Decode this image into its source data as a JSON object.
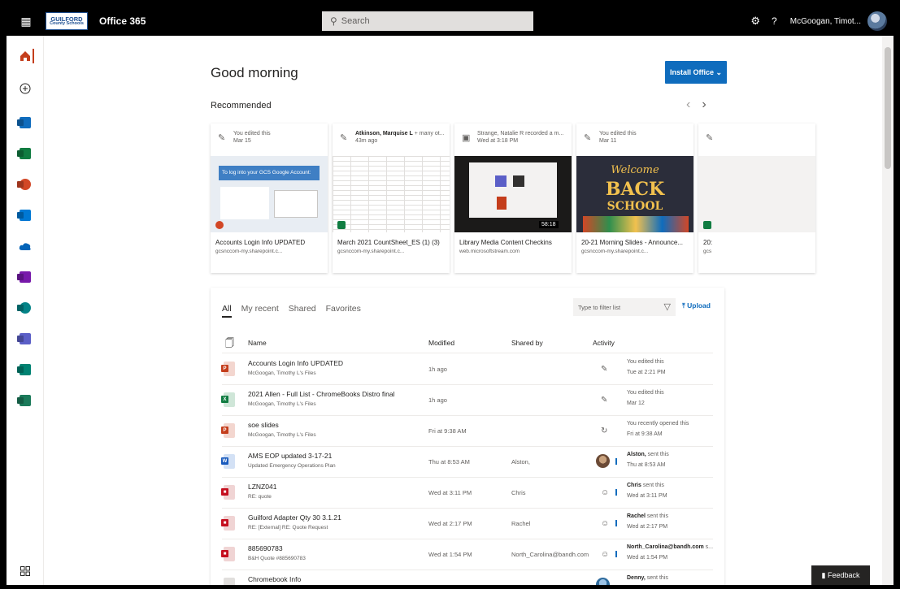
{
  "topbar": {
    "logo_line1": "GUILFORD",
    "logo_line2": "County Schools",
    "app_name": "Office 365",
    "search_placeholder": "Search",
    "user_name": "McGoogan, Timot..."
  },
  "rail": {
    "icons": [
      "home-icon",
      "create-icon",
      "outlook-icon",
      "excel-icon",
      "powerpoint-icon",
      "outlook-icon",
      "onedrive-icon",
      "onenote-icon",
      "sharepoint-icon",
      "teams-icon",
      "sway-icon",
      "planner-icon",
      "all-apps-icon"
    ]
  },
  "main": {
    "greeting": "Good morning",
    "install_button": "Install Office",
    "recommended_label": "Recommended"
  },
  "cards": [
    {
      "activity_line1": "You edited this",
      "activity_line2": "Mar 15",
      "title": "Accounts Login Info UPDATED",
      "url": "gcsnccom-my.sharepoint.c..."
    },
    {
      "activity_bold": "Atkinson, Marquise L",
      "activity_line1": " + many ot...",
      "activity_line2": "43m ago",
      "title": "March 2021 CountSheet_ES (1) (3)",
      "url": "gcsnccom-my.sharepoint.c..."
    },
    {
      "activity_line1": "Strange, Natalie R recorded a m...",
      "activity_line2": "Wed at 3:18 PM",
      "title": "Library Media Content Checkins",
      "url": "web.microsoftstream.com"
    },
    {
      "activity_line1": "You edited this",
      "activity_line2": "Mar 11",
      "title": "20-21 Morning Slides - Announce...",
      "url": "gcsnccom-my.sharepoint.c..."
    },
    {
      "activity_line1": "",
      "activity_line2": "",
      "title": "20:",
      "url": "gcs"
    }
  ],
  "card_thumbs": {
    "login_banner": "To log into your GCS Google Account:",
    "video_duration": "58:18",
    "welcome": "Welcome",
    "back": "BACK",
    "to_school": "SCHOOL"
  },
  "list": {
    "tabs": [
      "All",
      "My recent",
      "Shared",
      "Favorites"
    ],
    "filter_placeholder": "Type to filter list",
    "upload_label": "Upload",
    "columns": {
      "name": "Name",
      "modified": "Modified",
      "shared_by": "Shared by",
      "activity": "Activity"
    },
    "rows": [
      {
        "type": "ppt",
        "name": "Accounts Login Info UPDATED",
        "location": "McGoogan, Timothy L's Files",
        "modified": "1h ago",
        "shared_by": "",
        "act_bold": "",
        "act1": "You edited this",
        "act2": "Tue at 2:21 PM"
      },
      {
        "type": "xls",
        "name": "2021 Allen - Full List - ChromeBooks Distro final",
        "location": "McGoogan, Timothy L's Files",
        "modified": "1h ago",
        "shared_by": "",
        "act_bold": "",
        "act1": "You edited this",
        "act2": "Mar 12"
      },
      {
        "type": "ppt",
        "name": "soe slides",
        "location": "McGoogan, Timothy L's Files",
        "modified": "Fri at 9:38 AM",
        "shared_by": "",
        "act_bold": "",
        "act1": "You recently opened this",
        "act2": "Fri at 9:38 AM"
      },
      {
        "type": "doc",
        "name": "AMS EOP updated 3-17-21",
        "location": "Updated Emergency Operations Plan",
        "modified": "Thu at 8:53 AM",
        "shared_by": "Alston,",
        "act_bold": "Alston,",
        "act1": " sent this",
        "act2": "Thu at 8:53 AM"
      },
      {
        "type": "pdf",
        "name": "LZNZ041",
        "location": "RE: quote",
        "modified": "Wed at 3:11 PM",
        "shared_by": "Chris",
        "act_bold": "Chris",
        "act1": " sent this",
        "act2": "Wed at 3:11 PM"
      },
      {
        "type": "pdf",
        "name": "Guilford Adapter Qty 30 3.1.21",
        "location": "RE: [External] RE: Quote Request",
        "modified": "Wed at 2:17 PM",
        "shared_by": "Rachel",
        "act_bold": "Rachel",
        "act1": " sent this",
        "act2": "Wed at 2:17 PM"
      },
      {
        "type": "pdf",
        "name": "885690783",
        "location": "B&H Quote #885690783",
        "modified": "Wed at 1:54 PM",
        "shared_by": "North_Carolina@bandh.com",
        "act_bold": "North_Carolina@bandh.com",
        "act1": " s...",
        "act2": "Wed at 1:54 PM"
      },
      {
        "type": "file",
        "name": "Chromebook Info",
        "location": "",
        "modified": "",
        "shared_by": "",
        "act_bold": "Denny,",
        "act1": " sent this",
        "act2": ""
      }
    ]
  },
  "feedback_label": "Feedback",
  "colors": {
    "topbar": "#000000",
    "accent": "#0f6cbd",
    "word": "#185abd",
    "excel": "#107c41",
    "powerpoint": "#c43e1c",
    "onenote": "#7719aa",
    "teams": "#5b5fc7"
  }
}
